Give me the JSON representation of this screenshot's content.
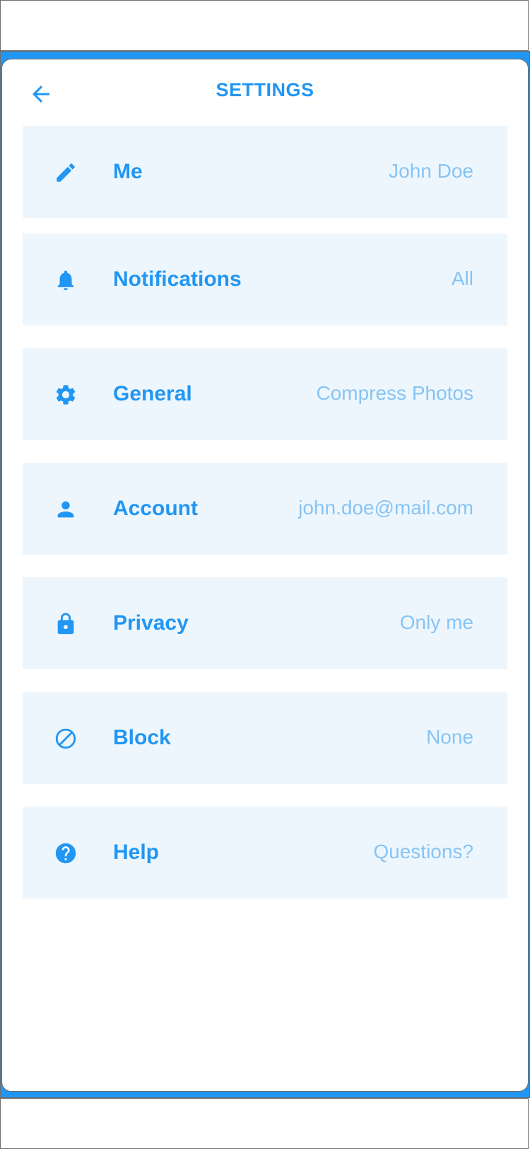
{
  "header": {
    "title": "SETTINGS"
  },
  "colors": {
    "accent": "#2196f3",
    "row_bg": "#eef6fd",
    "value_text": "#86c4f4"
  },
  "settings": [
    {
      "id": "me",
      "icon": "pencil-icon",
      "label": "Me",
      "value": "John Doe"
    },
    {
      "id": "notifications",
      "icon": "bell-icon",
      "label": "Notifications",
      "value": "All"
    },
    {
      "id": "general",
      "icon": "gear-icon",
      "label": "General",
      "value": "Compress Photos"
    },
    {
      "id": "account",
      "icon": "person-icon",
      "label": "Account",
      "value": "john.doe@mail.com"
    },
    {
      "id": "privacy",
      "icon": "lock-icon",
      "label": "Privacy",
      "value": "Only me"
    },
    {
      "id": "block",
      "icon": "block-icon",
      "label": "Block",
      "value": "None"
    },
    {
      "id": "help",
      "icon": "help-icon",
      "label": "Help",
      "value": "Questions?"
    }
  ]
}
